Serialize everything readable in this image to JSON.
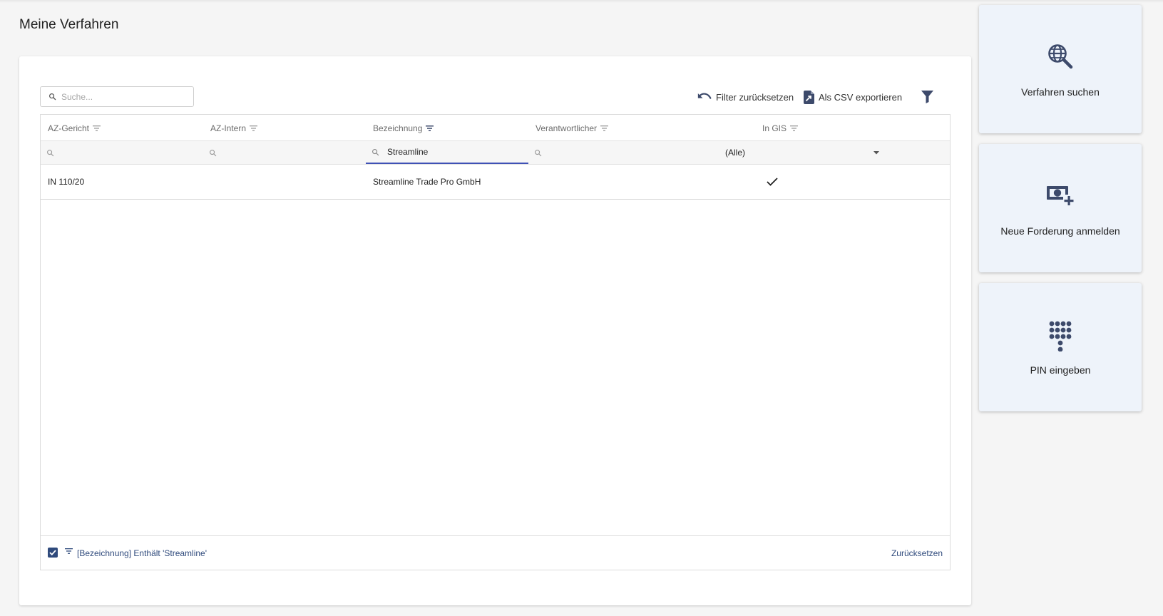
{
  "page": {
    "title": "Meine Verfahren"
  },
  "search": {
    "placeholder": "Suche..."
  },
  "toolbar": {
    "reset_label": "Filter zurücksetzen",
    "export_label": "Als CSV exportieren"
  },
  "grid": {
    "columns": [
      {
        "label": "AZ-Gericht"
      },
      {
        "label": "AZ-Intern"
      },
      {
        "label": "Bezeichnung"
      },
      {
        "label": "Verantwortlicher"
      },
      {
        "label": "In GIS"
      }
    ],
    "filters": {
      "az_gericht": "",
      "az_intern": "",
      "bezeichnung": "Streamline",
      "verantwortlicher": "",
      "in_gis": "(Alle)"
    },
    "rows": [
      {
        "az_gericht": "IN 110/20",
        "az_intern": "",
        "bezeichnung": "Streamline Trade Pro GmbH",
        "verantwortlicher": "",
        "in_gis": true
      }
    ],
    "footer": {
      "filter_text": "[Bezeichnung] Enthält 'Streamline'",
      "reset_label": "Zurücksetzen",
      "filter_enabled": true
    }
  },
  "actions": [
    {
      "label": "Verfahren suchen",
      "icon": "globe-search-icon"
    },
    {
      "label": "Neue Forderung anmelden",
      "icon": "money-add-icon"
    },
    {
      "label": "PIN eingeben",
      "icon": "dialpad-icon"
    }
  ],
  "colors": {
    "accent": "#2f4a7c",
    "active_filter_underline": "#3f51b5",
    "side_card_bg": "#eef3fa",
    "icon": "#3d4a6b"
  }
}
